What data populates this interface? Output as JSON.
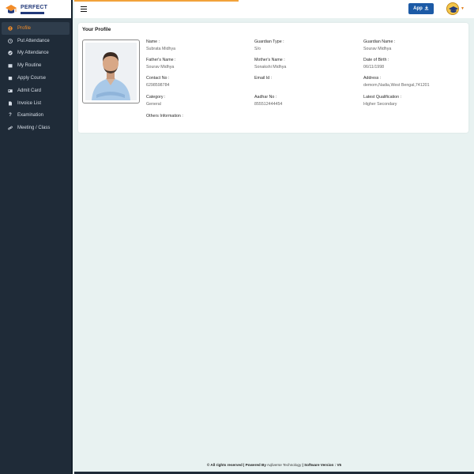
{
  "brand": {
    "name": "PERFECT"
  },
  "sidebar": {
    "items": [
      {
        "label": "Profile",
        "icon": "user-circle-icon",
        "active": true
      },
      {
        "label": "Put Attendance",
        "icon": "clock-icon"
      },
      {
        "label": "My Attendance",
        "icon": "check-circle-icon"
      },
      {
        "label": "My Routine",
        "icon": "calendar-icon"
      },
      {
        "label": "Apply Course",
        "icon": "book-icon"
      },
      {
        "label": "Admit Card",
        "icon": "id-card-icon"
      },
      {
        "label": "Invoice List",
        "icon": "file-icon"
      },
      {
        "label": "Examination",
        "icon": "question-icon"
      },
      {
        "label": "Meeting / Class",
        "icon": "link-icon"
      }
    ]
  },
  "header": {
    "app_button": "App"
  },
  "profile": {
    "title": "Your Profile",
    "name_label": "Name :",
    "name": "Subrata Midhya",
    "guardian_type_label": "Guardian Type :",
    "guardian_type": "S/o",
    "guardian_name_label": "Guardian Name :",
    "guardian_name": "Sourav Midhya",
    "father_label": "Father's Name :",
    "father": "Sourav Midhya",
    "mother_label": "Mother's Name :",
    "mother": "Sonakshi Midhya",
    "dob_label": "Date of Birth :",
    "dob": "06/11/1998",
    "contact_label": "Contact No :",
    "contact": "6298598784",
    "email_label": "Email Id :",
    "email": "",
    "address_label": "Address :",
    "address": "demom,Nadia,West Bengal,741201",
    "category_label": "Category :",
    "category": "General",
    "aadhar_label": "Aadhar No :",
    "aadhar": "855512444454",
    "qualification_label": "Latest Qualification :",
    "qualification": "Higher Secondary",
    "others_label": "Others Information :",
    "others": ""
  },
  "footer": {
    "rights": "© All rights reserved | Powered By",
    "company": "Aqliverse Technology",
    "version": "| Software Version : V5"
  },
  "colors": {
    "sidebar": "#1f2b38",
    "accent": "#f28c28",
    "primary": "#1c5aa6",
    "background": "#e8f2f1"
  }
}
